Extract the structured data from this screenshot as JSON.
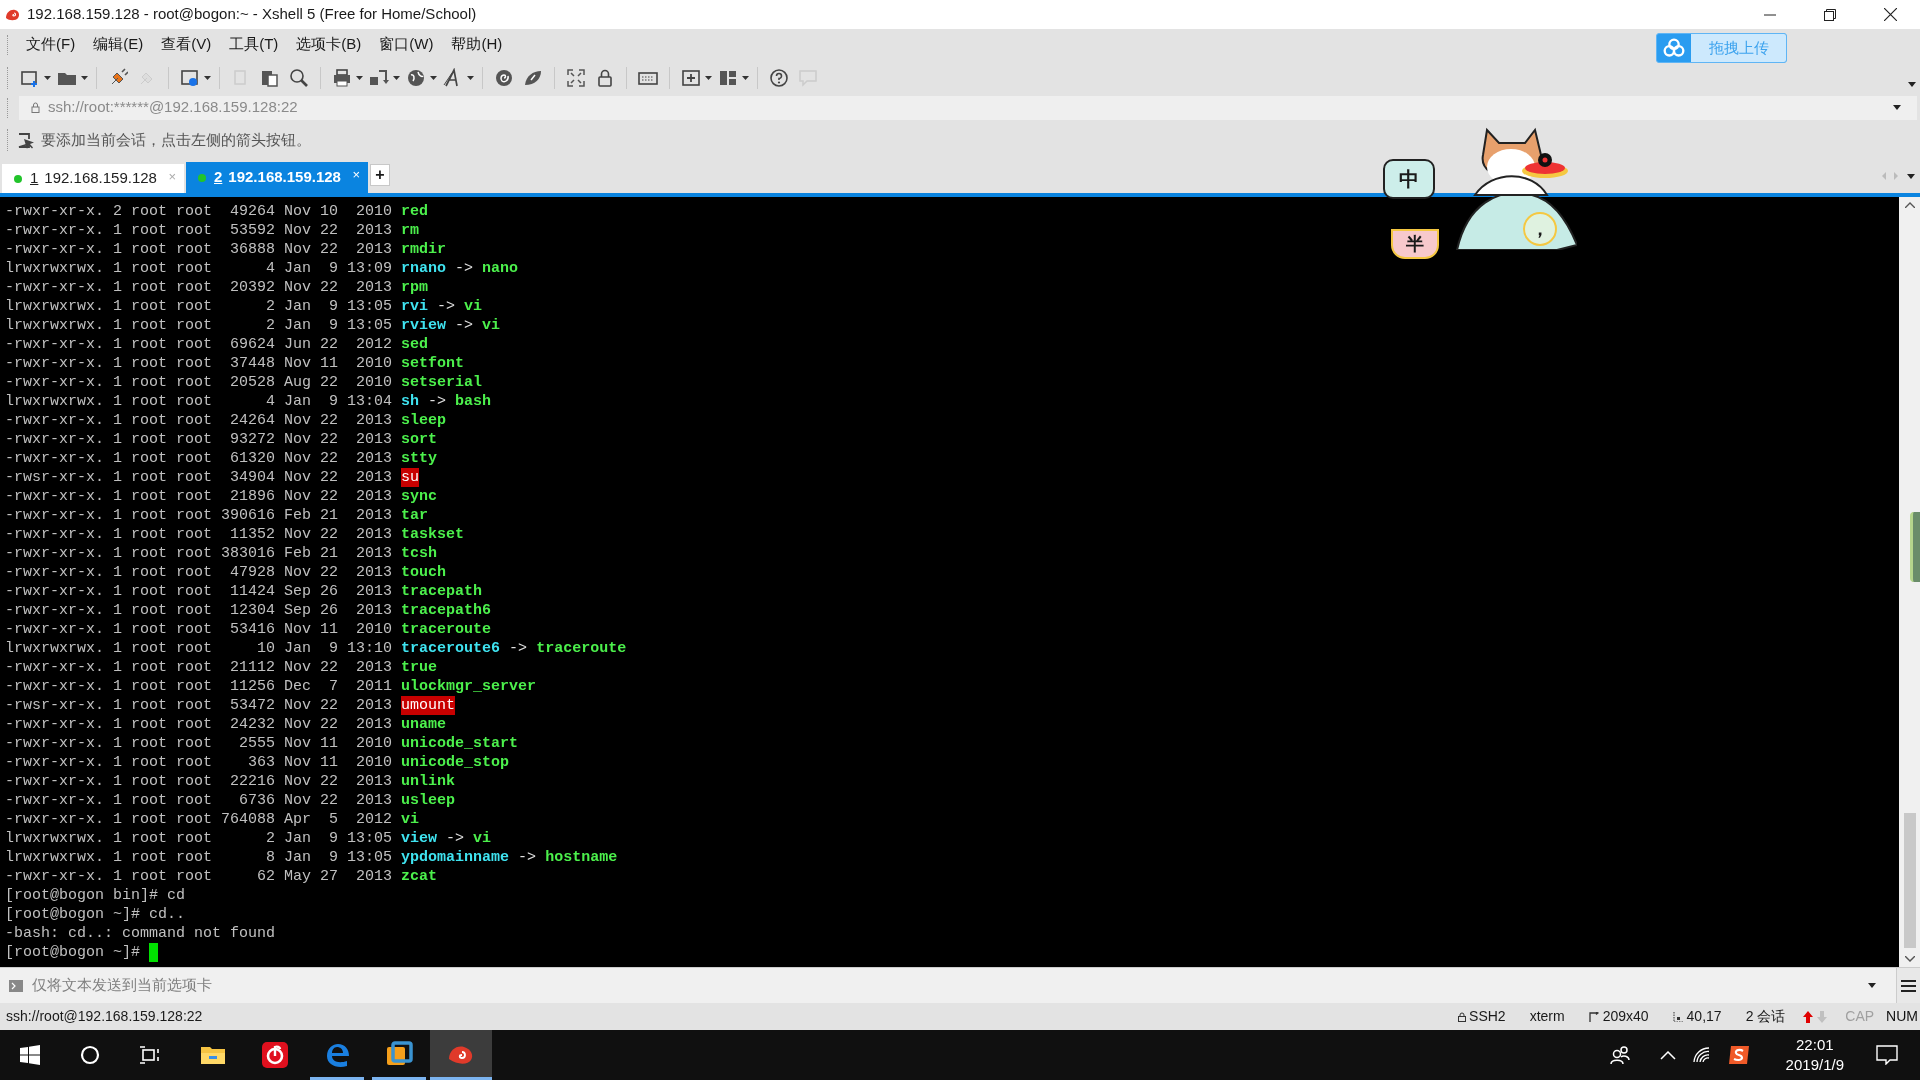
{
  "window": {
    "title": "192.168.159.128 - root@bogon:~ - Xshell 5 (Free for Home/School)"
  },
  "menu": [
    "文件(F)",
    "编辑(E)",
    "查看(V)",
    "工具(T)",
    "选项卡(B)",
    "窗口(W)",
    "帮助(H)"
  ],
  "upload_button": {
    "label": "拖拽上传"
  },
  "address_bar": {
    "value": "ssh://root:******@192.168.159.128:22"
  },
  "hint_bar": {
    "text": "要添加当前会话，点击左侧的箭头按钮。"
  },
  "tabs": [
    {
      "number": "1",
      "label": "192.168.159.128",
      "connected": true,
      "selected": false,
      "close": "×"
    },
    {
      "number": "2",
      "label": "192.168.159.128",
      "connected": true,
      "selected": true,
      "close": "×"
    }
  ],
  "new_tab": "+",
  "ime": {
    "mode": "中",
    "width": "半",
    "punctuation": "，"
  },
  "terminal": {
    "lines": [
      {
        "kind": "exec",
        "text": "-rwxr-xr-x. 2 root root  49264 Nov 10  2010",
        "name": "red"
      },
      {
        "kind": "exec",
        "text": "-rwxr-xr-x. 1 root root  53592 Nov 22  2013",
        "name": "rm"
      },
      {
        "kind": "exec",
        "text": "-rwxr-xr-x. 1 root root  36888 Nov 22  2013",
        "name": "rmdir"
      },
      {
        "kind": "link",
        "text": "lrwxrwxrwx. 1 root root      4 Jan  9 13:09",
        "name": "rnano",
        "arrow": "->",
        "target": "nano"
      },
      {
        "kind": "exec",
        "text": "-rwxr-xr-x. 1 root root  20392 Nov 22  2013",
        "name": "rpm"
      },
      {
        "kind": "link",
        "text": "lrwxrwxrwx. 1 root root      2 Jan  9 13:05",
        "name": "rvi",
        "arrow": "->",
        "target": "vi"
      },
      {
        "kind": "link",
        "text": "lrwxrwxrwx. 1 root root      2 Jan  9 13:05",
        "name": "rview",
        "arrow": "->",
        "target": "vi"
      },
      {
        "kind": "exec",
        "text": "-rwxr-xr-x. 1 root root  69624 Jun 22  2012",
        "name": "sed"
      },
      {
        "kind": "exec",
        "text": "-rwxr-xr-x. 1 root root  37448 Nov 11  2010",
        "name": "setfont"
      },
      {
        "kind": "exec",
        "text": "-rwxr-xr-x. 1 root root  20528 Aug 22  2010",
        "name": "setserial"
      },
      {
        "kind": "link",
        "text": "lrwxrwxrwx. 1 root root      4 Jan  9 13:04",
        "name": "sh",
        "arrow": "->",
        "target": "bash"
      },
      {
        "kind": "exec",
        "text": "-rwxr-xr-x. 1 root root  24264 Nov 22  2013",
        "name": "sleep"
      },
      {
        "kind": "exec",
        "text": "-rwxr-xr-x. 1 root root  93272 Nov 22  2013",
        "name": "sort"
      },
      {
        "kind": "exec",
        "text": "-rwxr-xr-x. 1 root root  61320 Nov 22  2013",
        "name": "stty"
      },
      {
        "kind": "setuid",
        "text": "-rwsr-xr-x. 1 root root  34904 Nov 22  2013",
        "name": "su"
      },
      {
        "kind": "exec",
        "text": "-rwxr-xr-x. 1 root root  21896 Nov 22  2013",
        "name": "sync"
      },
      {
        "kind": "exec",
        "text": "-rwxr-xr-x. 1 root root 390616 Feb 21  2013",
        "name": "tar"
      },
      {
        "kind": "exec",
        "text": "-rwxr-xr-x. 1 root root  11352 Nov 22  2013",
        "name": "taskset"
      },
      {
        "kind": "exec",
        "text": "-rwxr-xr-x. 1 root root 383016 Feb 21  2013",
        "name": "tcsh"
      },
      {
        "kind": "exec",
        "text": "-rwxr-xr-x. 1 root root  47928 Nov 22  2013",
        "name": "touch"
      },
      {
        "kind": "exec",
        "text": "-rwxr-xr-x. 1 root root  11424 Sep 26  2013",
        "name": "tracepath"
      },
      {
        "kind": "exec",
        "text": "-rwxr-xr-x. 1 root root  12304 Sep 26  2013",
        "name": "tracepath6"
      },
      {
        "kind": "exec",
        "text": "-rwxr-xr-x. 1 root root  53416 Nov 11  2010",
        "name": "traceroute"
      },
      {
        "kind": "link",
        "text": "lrwxrwxrwx. 1 root root     10 Jan  9 13:10",
        "name": "traceroute6",
        "arrow": "->",
        "target": "traceroute"
      },
      {
        "kind": "exec",
        "text": "-rwxr-xr-x. 1 root root  21112 Nov 22  2013",
        "name": "true"
      },
      {
        "kind": "exec",
        "text": "-rwxr-xr-x. 1 root root  11256 Dec  7  2011",
        "name": "ulockmgr_server"
      },
      {
        "kind": "setuid",
        "text": "-rwsr-xr-x. 1 root root  53472 Nov 22  2013",
        "name": "umount"
      },
      {
        "kind": "exec",
        "text": "-rwxr-xr-x. 1 root root  24232 Nov 22  2013",
        "name": "uname"
      },
      {
        "kind": "exec",
        "text": "-rwxr-xr-x. 1 root root   2555 Nov 11  2010",
        "name": "unicode_start"
      },
      {
        "kind": "exec",
        "text": "-rwxr-xr-x. 1 root root    363 Nov 11  2010",
        "name": "unicode_stop"
      },
      {
        "kind": "exec",
        "text": "-rwxr-xr-x. 1 root root  22216 Nov 22  2013",
        "name": "unlink"
      },
      {
        "kind": "exec",
        "text": "-rwxr-xr-x. 1 root root   6736 Nov 22  2013",
        "name": "usleep"
      },
      {
        "kind": "exec",
        "text": "-rwxr-xr-x. 1 root root 764088 Apr  5  2012",
        "name": "vi"
      },
      {
        "kind": "link",
        "text": "lrwxrwxrwx. 1 root root      2 Jan  9 13:05",
        "name": "view",
        "arrow": "->",
        "target": "vi"
      },
      {
        "kind": "link",
        "text": "lrwxrwxrwx. 1 root root      8 Jan  9 13:05",
        "name": "ypdomainname",
        "arrow": "->",
        "target": "hostname"
      },
      {
        "kind": "exec",
        "text": "-rwxr-xr-x. 1 root root     62 May 27  2013",
        "name": "zcat"
      },
      {
        "kind": "plain",
        "text": "[root@bogon bin]# cd"
      },
      {
        "kind": "plain",
        "text": "[root@bogon ~]# cd.."
      },
      {
        "kind": "plain",
        "text": "-bash: cd..: command not found"
      },
      {
        "kind": "prompt",
        "text": "[root@bogon ~]#"
      }
    ]
  },
  "send_bar": {
    "placeholder": "仅将文本发送到当前选项卡"
  },
  "status_bar": {
    "address": "ssh://root@192.168.159.128:22",
    "items": [
      {
        "kind": "protocol",
        "text": "SSH2"
      },
      {
        "kind": "terminal",
        "text": "xterm"
      },
      {
        "kind": "size",
        "text": "209x40"
      },
      {
        "kind": "position",
        "text": "40,17"
      },
      {
        "kind": "sessions",
        "text": "2 会话"
      }
    ],
    "upload": true,
    "download": false,
    "keys": [
      {
        "label": "CAP",
        "on": false
      },
      {
        "label": "NUM",
        "on": true
      }
    ]
  },
  "taskbar": {
    "apps": [
      {
        "kind": "explorer",
        "running": false,
        "active": false
      },
      {
        "kind": "music",
        "running": false,
        "active": false
      },
      {
        "kind": "edge",
        "running": true,
        "active": false
      },
      {
        "kind": "vmware",
        "running": true,
        "active": false
      },
      {
        "kind": "xshell",
        "running": true,
        "active": true
      }
    ],
    "time": "22:01",
    "date": "2019/1/9"
  }
}
